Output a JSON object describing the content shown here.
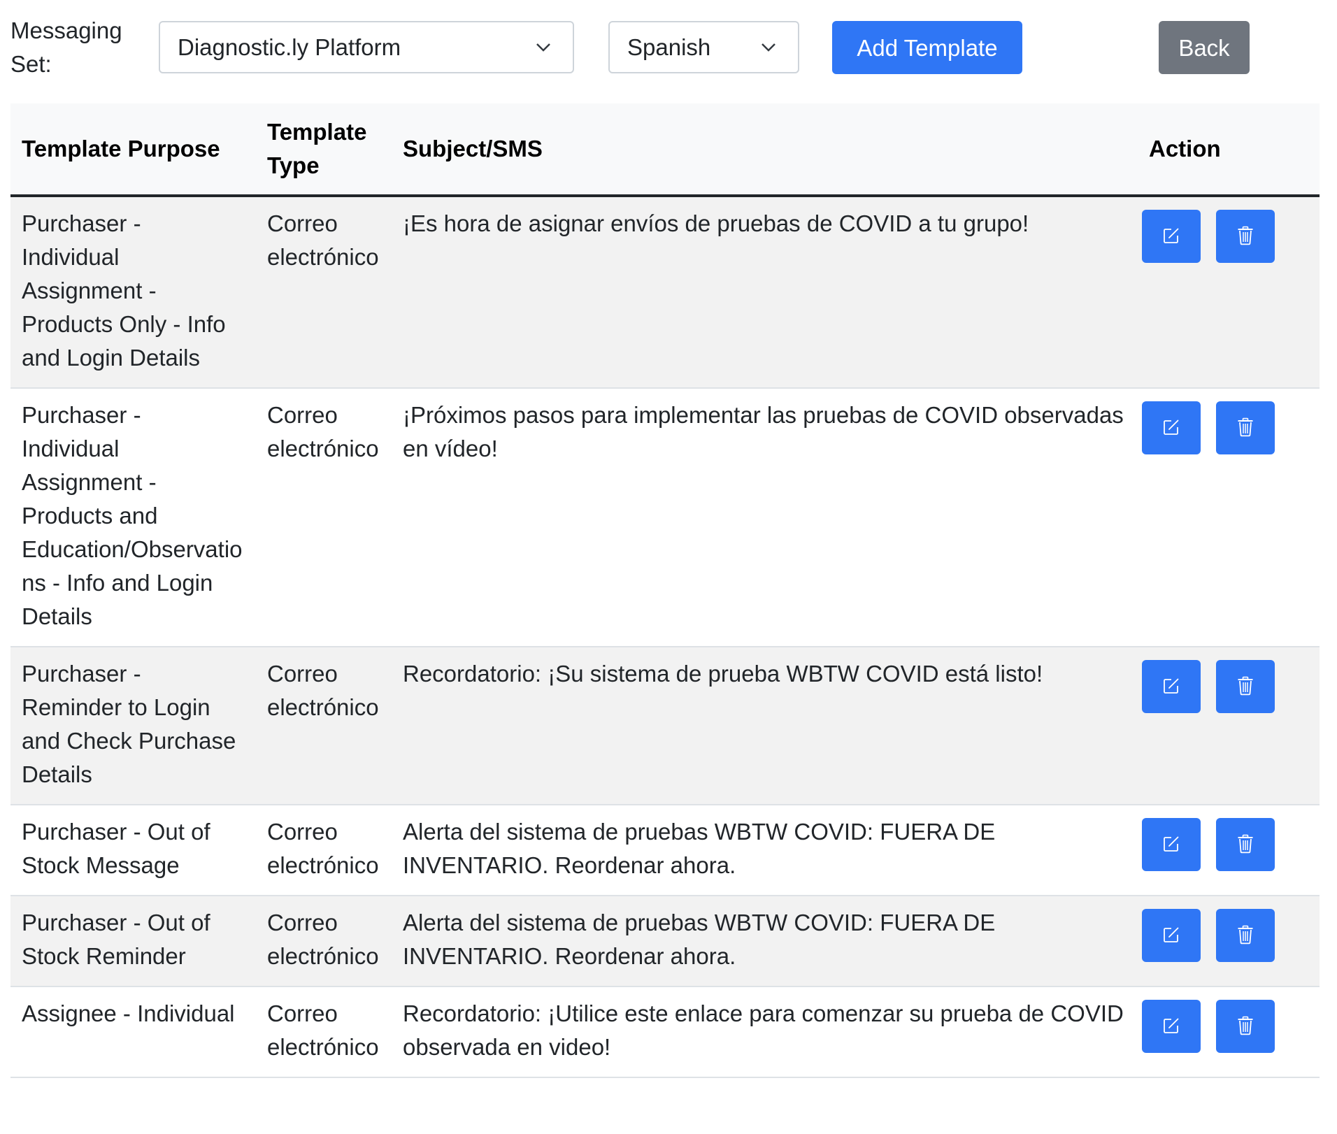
{
  "toolbar": {
    "messaging_set_label": "Messaging Set:",
    "platform_select": {
      "value": "Diagnostic.ly Platform",
      "icon": "chevron-down-icon"
    },
    "language_select": {
      "value": "Spanish",
      "icon": "chevron-down-icon"
    },
    "add_template_label": "Add Template",
    "back_label": "Back"
  },
  "colors": {
    "primary": "#2f76f5",
    "secondary": "#6f757e",
    "header_bg": "#f8f9fa",
    "striped_row_bg": "#f2f2f2",
    "text": "#212529"
  },
  "table": {
    "columns": [
      "Template Purpose",
      "Template Type",
      "Subject/SMS",
      "Action"
    ],
    "rows": [
      {
        "purpose": "Purchaser - Individual Assignment - Products Only - Info and Login Details",
        "type": "Correo electrónico",
        "subject": "¡Es hora de asignar envíos de pruebas de COVID a tu grupo!",
        "actions": [
          "edit-icon",
          "trash-icon"
        ]
      },
      {
        "purpose": "Purchaser - Individual Assignment - Products and Education/Observations - Info and Login Details",
        "type": "Correo electrónico",
        "subject": "¡Próximos pasos para implementar las pruebas de COVID observadas en vídeo!",
        "actions": [
          "edit-icon",
          "trash-icon"
        ]
      },
      {
        "purpose": "Purchaser - Reminder to Login and Check Purchase Details",
        "type": "Correo electrónico",
        "subject": "Recordatorio: ¡Su sistema de prueba WBTW COVID está listo!",
        "actions": [
          "edit-icon",
          "trash-icon"
        ]
      },
      {
        "purpose": "Purchaser - Out of Stock Message",
        "type": "Correo electrónico",
        "subject": "Alerta del sistema de pruebas WBTW COVID: FUERA DE INVENTARIO. Reordenar ahora.",
        "actions": [
          "edit-icon",
          "trash-icon"
        ]
      },
      {
        "purpose": "Purchaser - Out of Stock Reminder",
        "type": "Correo electrónico",
        "subject": "Alerta del sistema de pruebas WBTW COVID: FUERA DE INVENTARIO. Reordenar ahora.",
        "actions": [
          "edit-icon",
          "trash-icon"
        ]
      },
      {
        "purpose": "Assignee - Individual",
        "type": "Correo electrónico",
        "subject": "Recordatorio: ¡Utilice este enlace para comenzar su prueba de COVID observada en video!",
        "actions": [
          "edit-icon",
          "trash-icon"
        ]
      }
    ]
  }
}
